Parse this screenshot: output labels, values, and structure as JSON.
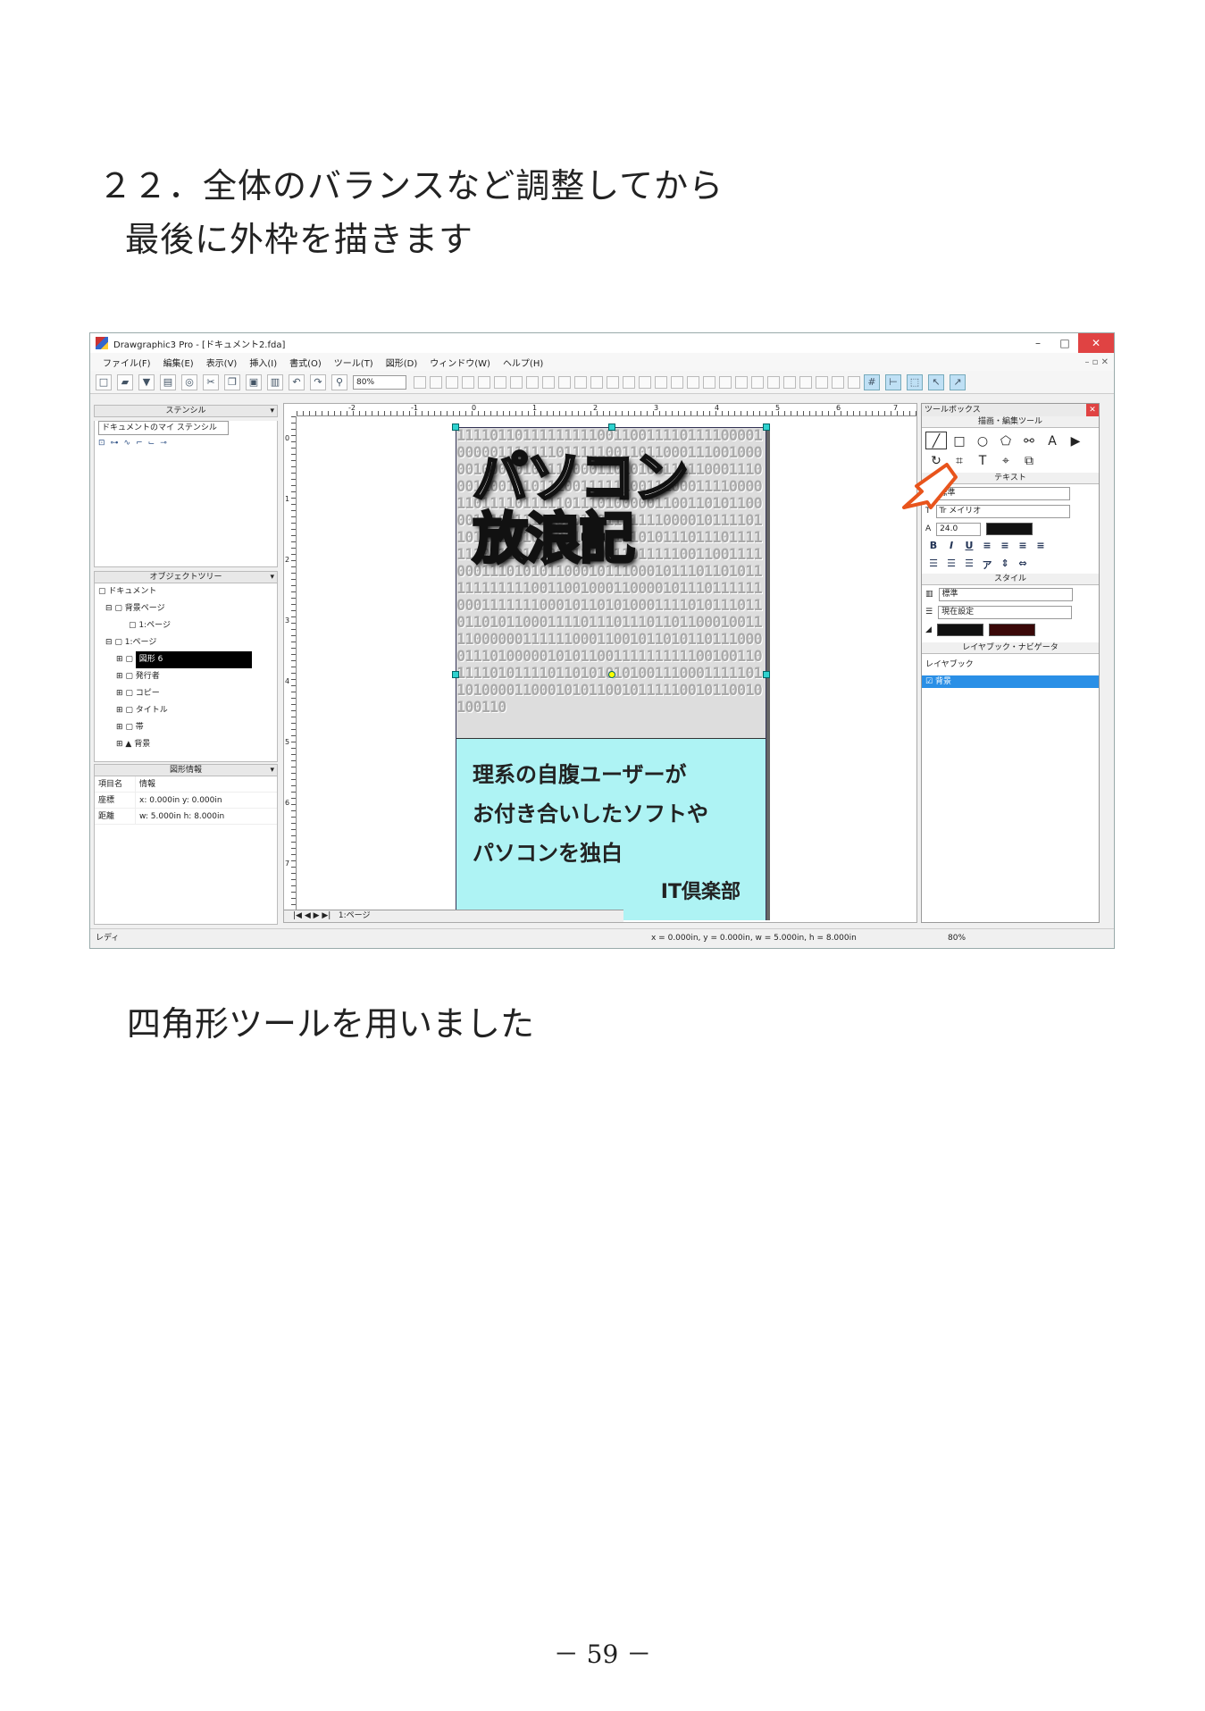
{
  "heading": {
    "line1": "２２．全体のバランスなど調整してから",
    "line2": "最後に外枠を描きます"
  },
  "caption": "四角形ツールを用いました",
  "page_number": "－ 59 －",
  "window": {
    "title": "Drawgraphic3 Pro - [ドキュメント2.fda]",
    "menu": [
      "ファイル(F)",
      "編集(E)",
      "表示(V)",
      "挿入(I)",
      "書式(O)",
      "ツール(T)",
      "図形(D)",
      "ウィンドウ(W)",
      "ヘルプ(H)"
    ],
    "zoom_value": "80%",
    "stencil": {
      "header": "ステンシル",
      "select": "ドキュメントのマイ ステンシル"
    },
    "object_tree": {
      "header": "オブジェクトツリー",
      "items": [
        "ドキュメント",
        "背景ページ",
        "1:ページ",
        "1:ページ",
        "図形 6",
        "発行者",
        "コピー",
        "タイトル",
        "帯",
        "背景"
      ]
    },
    "shape_info": {
      "header": "図形情報",
      "col1": "項目名",
      "col2": "情報",
      "rows": [
        {
          "name": "座標",
          "value": "x: 0.000in y: 0.000in"
        },
        {
          "name": "距離",
          "value": "w: 5.000in h: 8.000in"
        }
      ]
    },
    "page_tab": "1:ページ",
    "document": {
      "title_line1": "パソコン",
      "title_line2": "放浪記",
      "bits": "1111011011111111100110011110111100001000001111111011111001101100011100100000100000101110000110101001111100011100011001010111001111110011100011110000110111101111101110100000110011010110000111011111100011011111110000101111011011011010110110111101010111011101111111011101110011110111011111001100111100011101010110001011100010111011010111111111110011001000110000101110111111000111111100010110101000111101011101101101011000111101110111011011000100111100000011111100011001011010110111000011101000001010110011111111110010011011110101111011010101010011100011111011010000110001010110010111110010110010100110",
      "line1": "理系の自腹ユーザーが",
      "line2": "お付き合いしたソフトや",
      "line3": "パソコンを独白",
      "club": "IT倶楽部"
    },
    "toolbox": {
      "header": "ツールボックス",
      "draw_section": "描画・編集ツール",
      "text_section": "テキスト",
      "text_style": "標準",
      "font": "Tr メイリオ",
      "font_size": "24.0",
      "style_section": "スタイル",
      "style_value": "標準",
      "line_setting": "現在設定",
      "layer_section": "レイヤブック・ナビゲータ",
      "layer_book": "レイヤブック",
      "layer_item": "背景"
    },
    "status": {
      "left": "レディ",
      "coords": "x = 0.000in, y = 0.000in, w = 5.000in, h = 8.000in",
      "zoom": "80%"
    },
    "accent": "#e8541c"
  }
}
